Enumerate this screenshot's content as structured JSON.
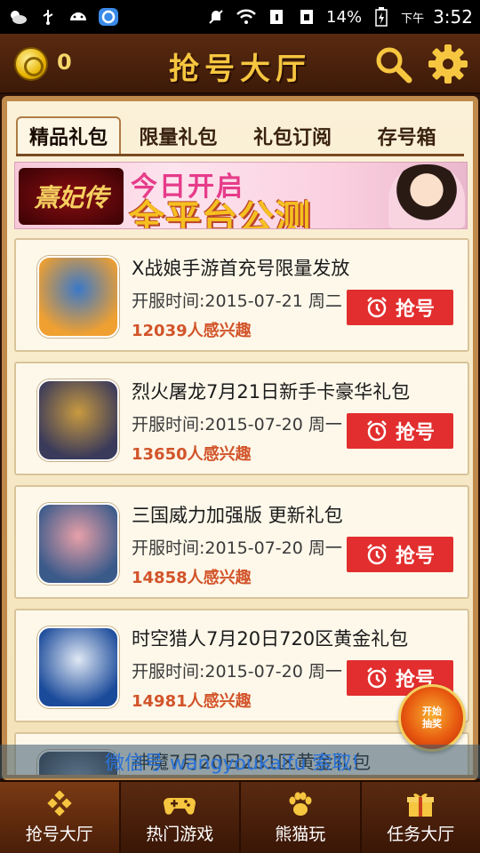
{
  "status_bar": {
    "battery": "14%",
    "ampm": "下午",
    "time": "3:52"
  },
  "header": {
    "coins": "0",
    "title": "抢号大厅"
  },
  "tabs": [
    {
      "label": "精品礼包",
      "active": true
    },
    {
      "label": "限量礼包",
      "active": false
    },
    {
      "label": "礼包订阅",
      "active": false
    },
    {
      "label": "存号箱",
      "active": false
    }
  ],
  "banner": {
    "logo_text": "熹妃传",
    "line1": "今日开启",
    "line2": "全平台公测"
  },
  "items": [
    {
      "title": "X战娘手游首充号限量发放",
      "date": "开服时间:2015-07-21 周二",
      "interest": "12039人感兴趣",
      "button": "抢号",
      "thumb_colors": [
        "#f0a030",
        "#3a78c8"
      ]
    },
    {
      "title": "烈火屠龙7月21日新手卡豪华礼包",
      "date": "开服时间:2015-07-20 周一",
      "interest": "13650人感兴趣",
      "button": "抢号",
      "thumb_colors": [
        "#3a3a5a",
        "#c89a40"
      ]
    },
    {
      "title": "三国威力加强版 更新礼包",
      "date": "开服时间:2015-07-20 周一",
      "interest": "14858人感兴趣",
      "button": "抢号",
      "thumb_colors": [
        "#3a5a8a",
        "#e8a0a8"
      ]
    },
    {
      "title": "时空猎人7月20日720区黄金礼包",
      "date": "开服时间:2015-07-20 周一",
      "interest": "14981人感兴趣",
      "button": "抢号",
      "thumb_colors": [
        "#1a4a9a",
        "#e0e8f4"
      ]
    },
    {
      "title": "神魔7月20日281区黄金礼包",
      "date": "",
      "interest": "",
      "button": "",
      "thumb_colors": [
        "#2a3040",
        "#8a9ab0"
      ]
    }
  ],
  "lottery": {
    "line1": "开始",
    "line2": "抽奖"
  },
  "marquee": {
    "text": "微信号 wangyoukaifu 索取!"
  },
  "bottom_nav": [
    {
      "label": "抢号大厅",
      "active": true,
      "icon": "diamond-grid-icon"
    },
    {
      "label": "热门游戏",
      "active": false,
      "icon": "gamepad-icon"
    },
    {
      "label": "熊猫玩",
      "active": false,
      "icon": "paw-icon"
    },
    {
      "label": "任务大厅",
      "active": false,
      "icon": "gift-icon"
    }
  ],
  "colors": {
    "accent_red": "#e22e2e",
    "header_brown": "#5a2a10",
    "title_gold": "#f6c640",
    "interest_orange": "#d2542a"
  }
}
